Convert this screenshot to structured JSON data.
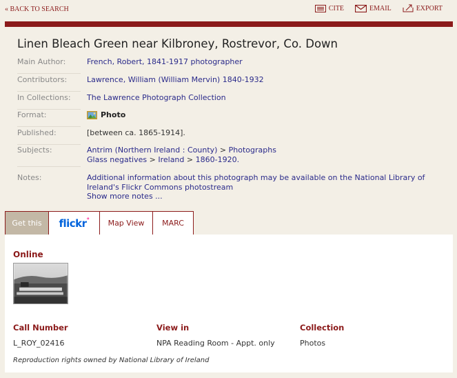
{
  "topbar": {
    "back_label": "« BACK TO SEARCH",
    "actions": [
      {
        "icon": "cite-icon",
        "label": "CITE"
      },
      {
        "icon": "email-icon",
        "label": "EMAIL"
      },
      {
        "icon": "export-icon",
        "label": "EXPORT"
      }
    ]
  },
  "record": {
    "title": "Linen Bleach Green near Kilbroney, Rostrevor, Co. Down",
    "main_author": {
      "label": "Main Author:",
      "value": "French, Robert, 1841-1917 photographer"
    },
    "contributors": {
      "label": "Contributors:",
      "value": "Lawrence, William (William Mervin) 1840-1932"
    },
    "collections": {
      "label": "In Collections:",
      "value": "The Lawrence Photograph Collection"
    },
    "format": {
      "label": "Format:",
      "value": "Photo",
      "icon": "photo-icon"
    },
    "published": {
      "label": "Published:",
      "value": "[between ca. 1865-1914]."
    },
    "subjects": {
      "label": "Subjects:",
      "line1": [
        "Antrim (Northern Ireland : County)",
        "Photographs"
      ],
      "line2": [
        "Glass negatives",
        "Ireland",
        "1860-1920."
      ]
    },
    "notes": {
      "label": "Notes:",
      "value": "Additional information about this photograph may be available on the National Library of Ireland's Flickr Commons photostream",
      "more": "Show more notes ..."
    }
  },
  "tabs": [
    {
      "label": "Get this",
      "active": true
    },
    {
      "label": "flickr",
      "logo": true
    },
    {
      "label": "Map View"
    },
    {
      "label": "MARC"
    }
  ],
  "holdings": {
    "online_title": "Online",
    "call_number_head": "Call Number",
    "call_number": "L_ROY_02416",
    "view_in_head": "View in",
    "view_in": "NPA Reading Room - Appt. only",
    "collection_head": "Collection",
    "collection": "Photos",
    "rights": "Reproduction rights owned by National Library of Ireland"
  },
  "colors": {
    "accent": "#8b1a1a",
    "link": "#2a2a8a",
    "background": "#f3efe6"
  }
}
